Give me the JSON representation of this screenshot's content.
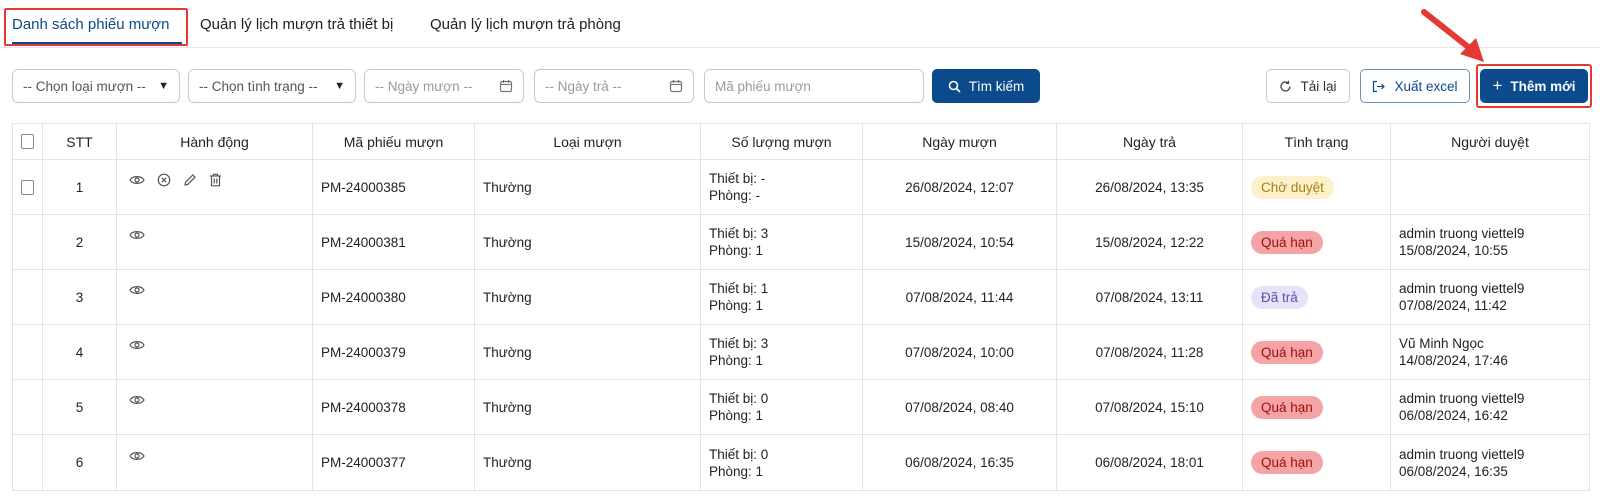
{
  "tabs": [
    {
      "label": "Danh sách phiếu mượn"
    },
    {
      "label": "Quản lý lịch mượn trả thiết bị"
    },
    {
      "label": "Quản lý lịch mượn trả phòng"
    }
  ],
  "filters": {
    "loai_muon": "-- Chọn loại mượn --",
    "tinh_trang": "-- Chọn tình trạng --",
    "ngay_muon_placeholder": "-- Ngày mượn --",
    "ngay_tra_placeholder": "-- Ngày trả --",
    "ma_phieu_placeholder": "Mã phiếu mượn",
    "search_label": "Tìm kiếm"
  },
  "actions": {
    "reload_label": "Tải lại",
    "export_label": "Xuất excel",
    "add_label": "Thêm mới"
  },
  "colors": {
    "primary": "#0b4a8b",
    "highlight": "#e53935"
  },
  "table": {
    "headers": [
      "STT",
      "Hành động",
      "Mã phiếu mượn",
      "Loại mượn",
      "Số lượng mượn",
      "Ngày mượn",
      "Ngày trả",
      "Tình trạng",
      "Người duyệt"
    ],
    "rows": [
      {
        "stt": "1",
        "icons": [
          "eye-icon",
          "cancel-icon",
          "edit-icon",
          "delete-icon"
        ],
        "ma": "PM-24000385",
        "loai": "Thường",
        "tb": "Thiết bị: -",
        "phong": "Phòng: -",
        "ngay_muon": "26/08/2024, 12:07",
        "ngay_tra": "26/08/2024, 13:35",
        "tinh_trang": "Chờ duyệt",
        "status": "wait",
        "duyet_name": "",
        "duyet_time": "",
        "checkbox": true
      },
      {
        "stt": "2",
        "icons": [
          "eye-icon"
        ],
        "ma": "PM-24000381",
        "loai": "Thường",
        "tb": "Thiết bị: 3",
        "phong": "Phòng: 1",
        "ngay_muon": "15/08/2024, 10:54",
        "ngay_tra": "15/08/2024, 12:22",
        "tinh_trang": "Quá hạn",
        "status": "over",
        "duyet_name": "admin truong viettel9",
        "duyet_time": "15/08/2024, 10:55",
        "checkbox": false
      },
      {
        "stt": "3",
        "icons": [
          "eye-icon"
        ],
        "ma": "PM-24000380",
        "loai": "Thường",
        "tb": "Thiết bị: 1",
        "phong": "Phòng: 1",
        "ngay_muon": "07/08/2024, 11:44",
        "ngay_tra": "07/08/2024, 13:11",
        "tinh_trang": "Đã trả",
        "status": "done",
        "duyet_name": "admin truong viettel9",
        "duyet_time": "07/08/2024, 11:42",
        "checkbox": false
      },
      {
        "stt": "4",
        "icons": [
          "eye-icon"
        ],
        "ma": "PM-24000379",
        "loai": "Thường",
        "tb": "Thiết bị: 3",
        "phong": "Phòng: 1",
        "ngay_muon": "07/08/2024, 10:00",
        "ngay_tra": "07/08/2024, 11:28",
        "tinh_trang": "Quá hạn",
        "status": "over",
        "duyet_name": "Vũ Minh Ngọc",
        "duyet_time": "14/08/2024, 17:46",
        "checkbox": false
      },
      {
        "stt": "5",
        "icons": [
          "eye-icon"
        ],
        "ma": "PM-24000378",
        "loai": "Thường",
        "tb": "Thiết bị: 0",
        "phong": "Phòng: 1",
        "ngay_muon": "07/08/2024, 08:40",
        "ngay_tra": "07/08/2024, 15:10",
        "tinh_trang": "Quá hạn",
        "status": "over",
        "duyet_name": "admin truong viettel9",
        "duyet_time": "06/08/2024, 16:42",
        "checkbox": false
      },
      {
        "stt": "6",
        "icons": [
          "eye-icon"
        ],
        "ma": "PM-24000377",
        "loai": "Thường",
        "tb": "Thiết bị: 0",
        "phong": "Phòng: 1",
        "ngay_muon": "06/08/2024, 16:35",
        "ngay_tra": "06/08/2024, 18:01",
        "tinh_trang": "Quá hạn",
        "status": "over",
        "duyet_name": "admin truong viettel9",
        "duyet_time": "06/08/2024, 16:35",
        "checkbox": false
      }
    ]
  }
}
